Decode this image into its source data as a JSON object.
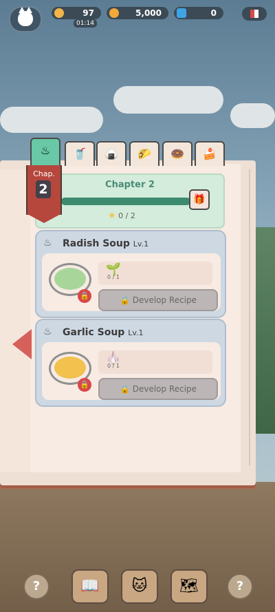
{
  "hud": {
    "energy": "97",
    "timer": "01:14",
    "coins": "5,000",
    "gems": "0"
  },
  "tabs": [
    {
      "icon": "soup-bowl-icon",
      "glyph": "♨"
    },
    {
      "icon": "drink-icon",
      "glyph": "🥤"
    },
    {
      "icon": "onigiri-icon",
      "glyph": "🍙"
    },
    {
      "icon": "taco-icon",
      "glyph": "🌮"
    },
    {
      "icon": "donut-icon",
      "glyph": "🍩"
    },
    {
      "icon": "cake-icon",
      "glyph": "🍰"
    }
  ],
  "chapter": {
    "label": "Chap.",
    "number": "2",
    "title": "Chapter 2",
    "stars": "0 / 2",
    "progress_fraction": 1.0
  },
  "recipes": [
    {
      "name": "Radish Soup",
      "level": "Lv.1",
      "ingredient": "radish-icon",
      "ingredient_count": "0 / 1",
      "button": "Develop Recipe",
      "broth_color": "#a8d69a"
    },
    {
      "name": "Garlic Soup",
      "level": "Lv.1",
      "ingredient": "garlic-icon",
      "ingredient_count": "0 / 1",
      "button": "Develop Recipe",
      "broth_color": "#f2c14e"
    }
  ],
  "nav": {
    "help_left": "?",
    "help_right": "?"
  }
}
